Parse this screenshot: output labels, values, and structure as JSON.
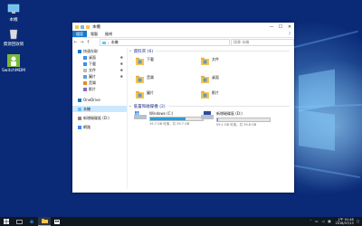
{
  "desktop": {
    "icons": [
      {
        "label": "本機"
      },
      {
        "label": "資源回收筒"
      },
      {
        "label": "SwitchMDM"
      }
    ]
  },
  "window": {
    "title": "本機",
    "ribbon_tabs": [
      "檔案",
      "電腦",
      "檢視"
    ],
    "address": "本機",
    "search_placeholder": "搜尋 本機",
    "controls": {
      "minimize": "—",
      "maximize": "☐",
      "close": "✕"
    }
  },
  "nav": {
    "items": [
      {
        "label": "快速存取",
        "pinned": false,
        "selected": false,
        "icon": "star-icon",
        "indent": 0
      },
      {
        "label": "桌面",
        "pinned": true,
        "selected": false,
        "icon": "desktop-icon",
        "indent": 1
      },
      {
        "label": "下載",
        "pinned": true,
        "selected": false,
        "icon": "download-icon",
        "indent": 1
      },
      {
        "label": "文件",
        "pinned": true,
        "selected": false,
        "icon": "document-icon",
        "indent": 1
      },
      {
        "label": "圖片",
        "pinned": true,
        "selected": false,
        "icon": "picture-icon",
        "indent": 1
      },
      {
        "label": "音樂",
        "pinned": false,
        "selected": false,
        "icon": "music-icon",
        "indent": 1
      },
      {
        "label": "影片",
        "pinned": false,
        "selected": false,
        "icon": "video-icon",
        "indent": 1
      },
      {
        "label": "OneDrive",
        "pinned": false,
        "selected": false,
        "icon": "cloud-icon",
        "indent": 0
      },
      {
        "label": "本機",
        "pinned": false,
        "selected": true,
        "icon": "computer-icon",
        "indent": 0
      },
      {
        "label": "新增磁碟區 (D:)",
        "pinned": false,
        "selected": false,
        "icon": "drive-icon",
        "indent": 0
      },
      {
        "label": "網路",
        "pinned": false,
        "selected": false,
        "icon": "network-icon",
        "indent": 0
      }
    ]
  },
  "content": {
    "folders_header": "資料夾 (6)",
    "folders": [
      {
        "label": "下載"
      },
      {
        "label": "文件"
      },
      {
        "label": "音樂"
      },
      {
        "label": "桌面"
      },
      {
        "label": "圖片"
      },
      {
        "label": "影片"
      }
    ],
    "drives_header": "裝置和磁碟機 (2)",
    "drives": [
      {
        "label": "Windows (C:)",
        "info": "19.7 GB 可用，共 59.7 GB",
        "used_fraction": 0.67
      },
      {
        "label": "新增磁碟區 (D:)",
        "info": "59.1 GB 可用，共 59.8 GB",
        "used_fraction": 0.01
      }
    ]
  },
  "taskbar": {
    "clock_time": "上午 01:48",
    "clock_date": "2016/07/13"
  },
  "colors": {
    "accent": "#1979ca",
    "folder": "#f3c552",
    "selected": "#cce8ff"
  }
}
